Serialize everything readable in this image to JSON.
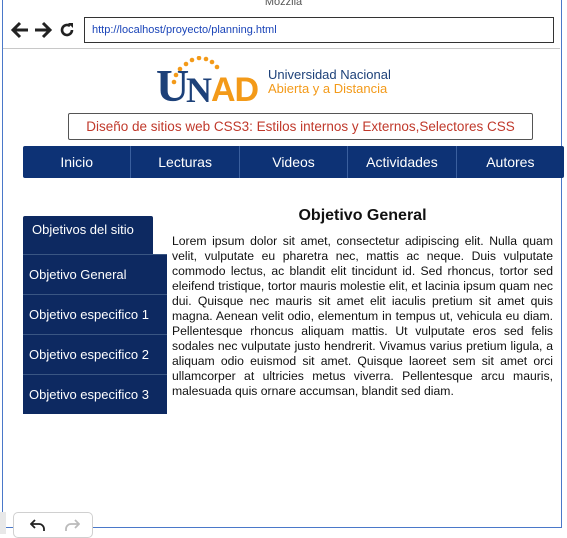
{
  "window": {
    "title": "Mozzila"
  },
  "browser": {
    "url": "http://localhost/proyecto/planning.html",
    "icons": [
      "back-icon",
      "forward-icon",
      "reload-icon"
    ]
  },
  "logo": {
    "letter_u": "U",
    "letter_n": "N",
    "letters_ad": "AD",
    "line1": "Universidad Nacional",
    "line2": "Abierta y a Distancia"
  },
  "page": {
    "subtitle": "Diseño de sitios web CSS3: Estilos internos y Externos,Selectores CSS"
  },
  "nav": {
    "items": [
      {
        "label": "Inicio"
      },
      {
        "label": "Lecturas"
      },
      {
        "label": "Videos"
      },
      {
        "label": "Actividades"
      },
      {
        "label": "Autores"
      }
    ]
  },
  "sidebar": {
    "header": "Objetivos del sitio",
    "items": [
      {
        "label": "Objetivo General"
      },
      {
        "label": "Objetivo especifico 1"
      },
      {
        "label": "Objetivo especifico 2"
      },
      {
        "label": "Objetivo especifico 3"
      }
    ]
  },
  "main": {
    "heading": "Objetivo General",
    "body": "Lorem ipsum dolor sit amet, consectetur adipiscing elit. Nulla quam velit, vulputate eu pharetra nec, mattis ac neque. Duis vulputate commodo lectus, ac blandit elit tincidunt id. Sed rhoncus, tortor sed eleifend tristique, tortor mauris molestie elit, et lacinia ipsum quam nec dui. Quisque nec mauris sit amet elit iaculis pretium sit amet quis magna. Aenean velit odio, elementum in tempus ut, vehicula eu diam. Pellentesque rhoncus aliquam mattis. Ut vulputate eros sed felis sodales nec vulputate justo hendrerit. Vivamus varius pretium ligula, a aliquam odio euismod sit amet. Quisque laoreet sem sit amet orci ullamcorper at ultricies metus viverra. Pellentesque arcu mauris, malesuada quis ornare accumsan, blandit sed diam."
  },
  "colors": {
    "nav_bg": "#0d3275",
    "sidebar_bg": "#0d2961",
    "subtitle_text": "#c0392b",
    "logo_blue": "#1d4179",
    "logo_orange": "#f39a19",
    "url_text": "#1a44b8"
  }
}
